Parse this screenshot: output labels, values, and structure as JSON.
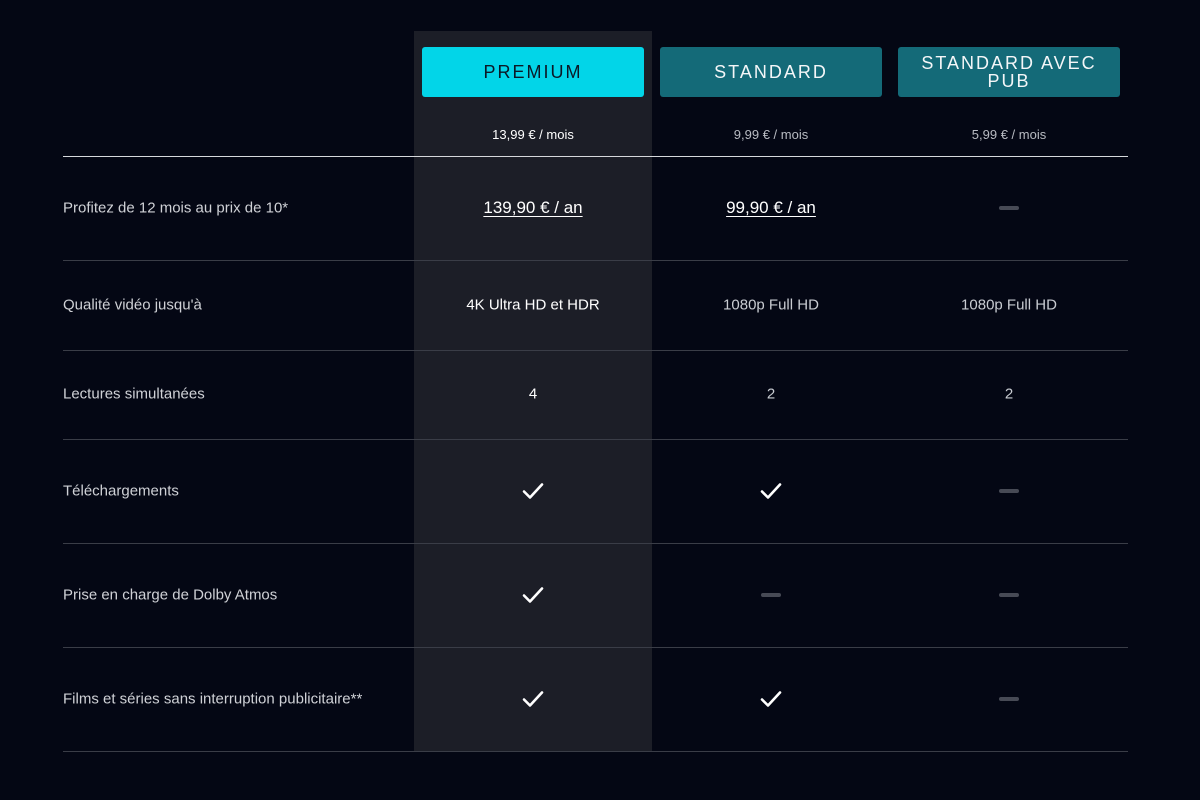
{
  "plans": [
    {
      "name": "PREMIUM",
      "price": "13,99 € / mois"
    },
    {
      "name": "STANDARD",
      "price": "9,99 € / mois"
    },
    {
      "name": "STANDARD AVEC PUB",
      "price": "5,99 € / mois"
    }
  ],
  "rows": {
    "annual": {
      "label": "Profitez de 12 mois au prix de 10*",
      "premium": "139,90 € / an",
      "standard": "99,90 € / an",
      "ads": "unavailable"
    },
    "quality": {
      "label": "Qualité vidéo jusqu'à",
      "premium": "4K Ultra HD et HDR",
      "standard": "1080p Full HD",
      "ads": "1080p Full HD"
    },
    "streams": {
      "label": "Lectures simultanées",
      "premium": "4",
      "standard": "2",
      "ads": "2"
    },
    "downloads": {
      "label": "Téléchargements",
      "premium": "included",
      "standard": "included",
      "ads": "unavailable"
    },
    "dolby": {
      "label": "Prise en charge de Dolby Atmos",
      "premium": "included",
      "standard": "unavailable",
      "ads": "unavailable"
    },
    "no_ads": {
      "label": "Films et séries sans interruption publicitaire**",
      "premium": "included",
      "standard": "included",
      "ads": "unavailable"
    }
  },
  "icons": {
    "included": "check-icon",
    "unavailable": "dash-icon"
  },
  "colors": {
    "background": "#040714",
    "premium_accent": "#02d5e8",
    "standard_button": "#146a78",
    "premium_column": "#1c1e27"
  }
}
